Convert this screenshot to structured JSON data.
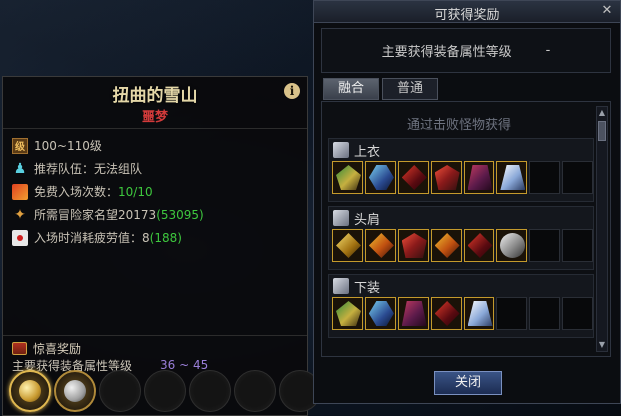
{
  "dungeon": {
    "name": "扭曲的雪山",
    "difficulty": "噩梦",
    "info_icon": "info-icon",
    "info_rows": [
      {
        "icon": "level-badge-icon",
        "label": "100~110级",
        "value": "",
        "extra": ""
      },
      {
        "icon": "party-icon",
        "label": "推荐队伍：",
        "value": "无法组队",
        "extra": ""
      },
      {
        "icon": "entry-ticket-icon",
        "label": "免费入场次数：",
        "value": "10/10",
        "extra": ""
      },
      {
        "icon": "reputation-icon",
        "label": "所需冒险家名望 ",
        "value": "20173",
        "extra": "(53095)"
      },
      {
        "icon": "fatigue-icon",
        "label": "入场时消耗疲劳值：",
        "value": "8",
        "extra": "(188)"
      }
    ],
    "reward": {
      "title": "惊喜奖励",
      "subtitle": "主要获得装备属性等级",
      "range": "36 ~ 45",
      "slots_filled": 2,
      "slots_total": 7
    }
  },
  "reward_window": {
    "title": "可获得奖励",
    "close_symbol": "✕",
    "summary_label": "主要获得装备属性等级",
    "summary_value": "-",
    "tabs": [
      {
        "label": "融合",
        "active": true
      },
      {
        "label": "普通",
        "active": false
      }
    ],
    "subheading": "通过击败怪物获得",
    "categories": [
      {
        "name": "上衣",
        "icon": "top-armor-icon",
        "items": [
          "green",
          "blue",
          "red",
          "crimson",
          "purple",
          "silver"
        ],
        "empty": 2
      },
      {
        "name": "头肩",
        "icon": "shoulder-armor-icon",
        "items": [
          "gold",
          "orange",
          "crimson",
          "orange",
          "red",
          "steel"
        ],
        "empty": 2
      },
      {
        "name": "下装",
        "icon": "pants-armor-icon",
        "items": [
          "green",
          "blue",
          "purple",
          "red",
          "silver"
        ],
        "empty": 3
      }
    ],
    "close_button": "关闭"
  },
  "colors": {
    "dungeon_name": "#e4d7a8",
    "difficulty": "#d23a3a",
    "accent_green": "#3ec83e",
    "range_purple": "#9a7ed8",
    "item_border": "#c49a2c"
  }
}
